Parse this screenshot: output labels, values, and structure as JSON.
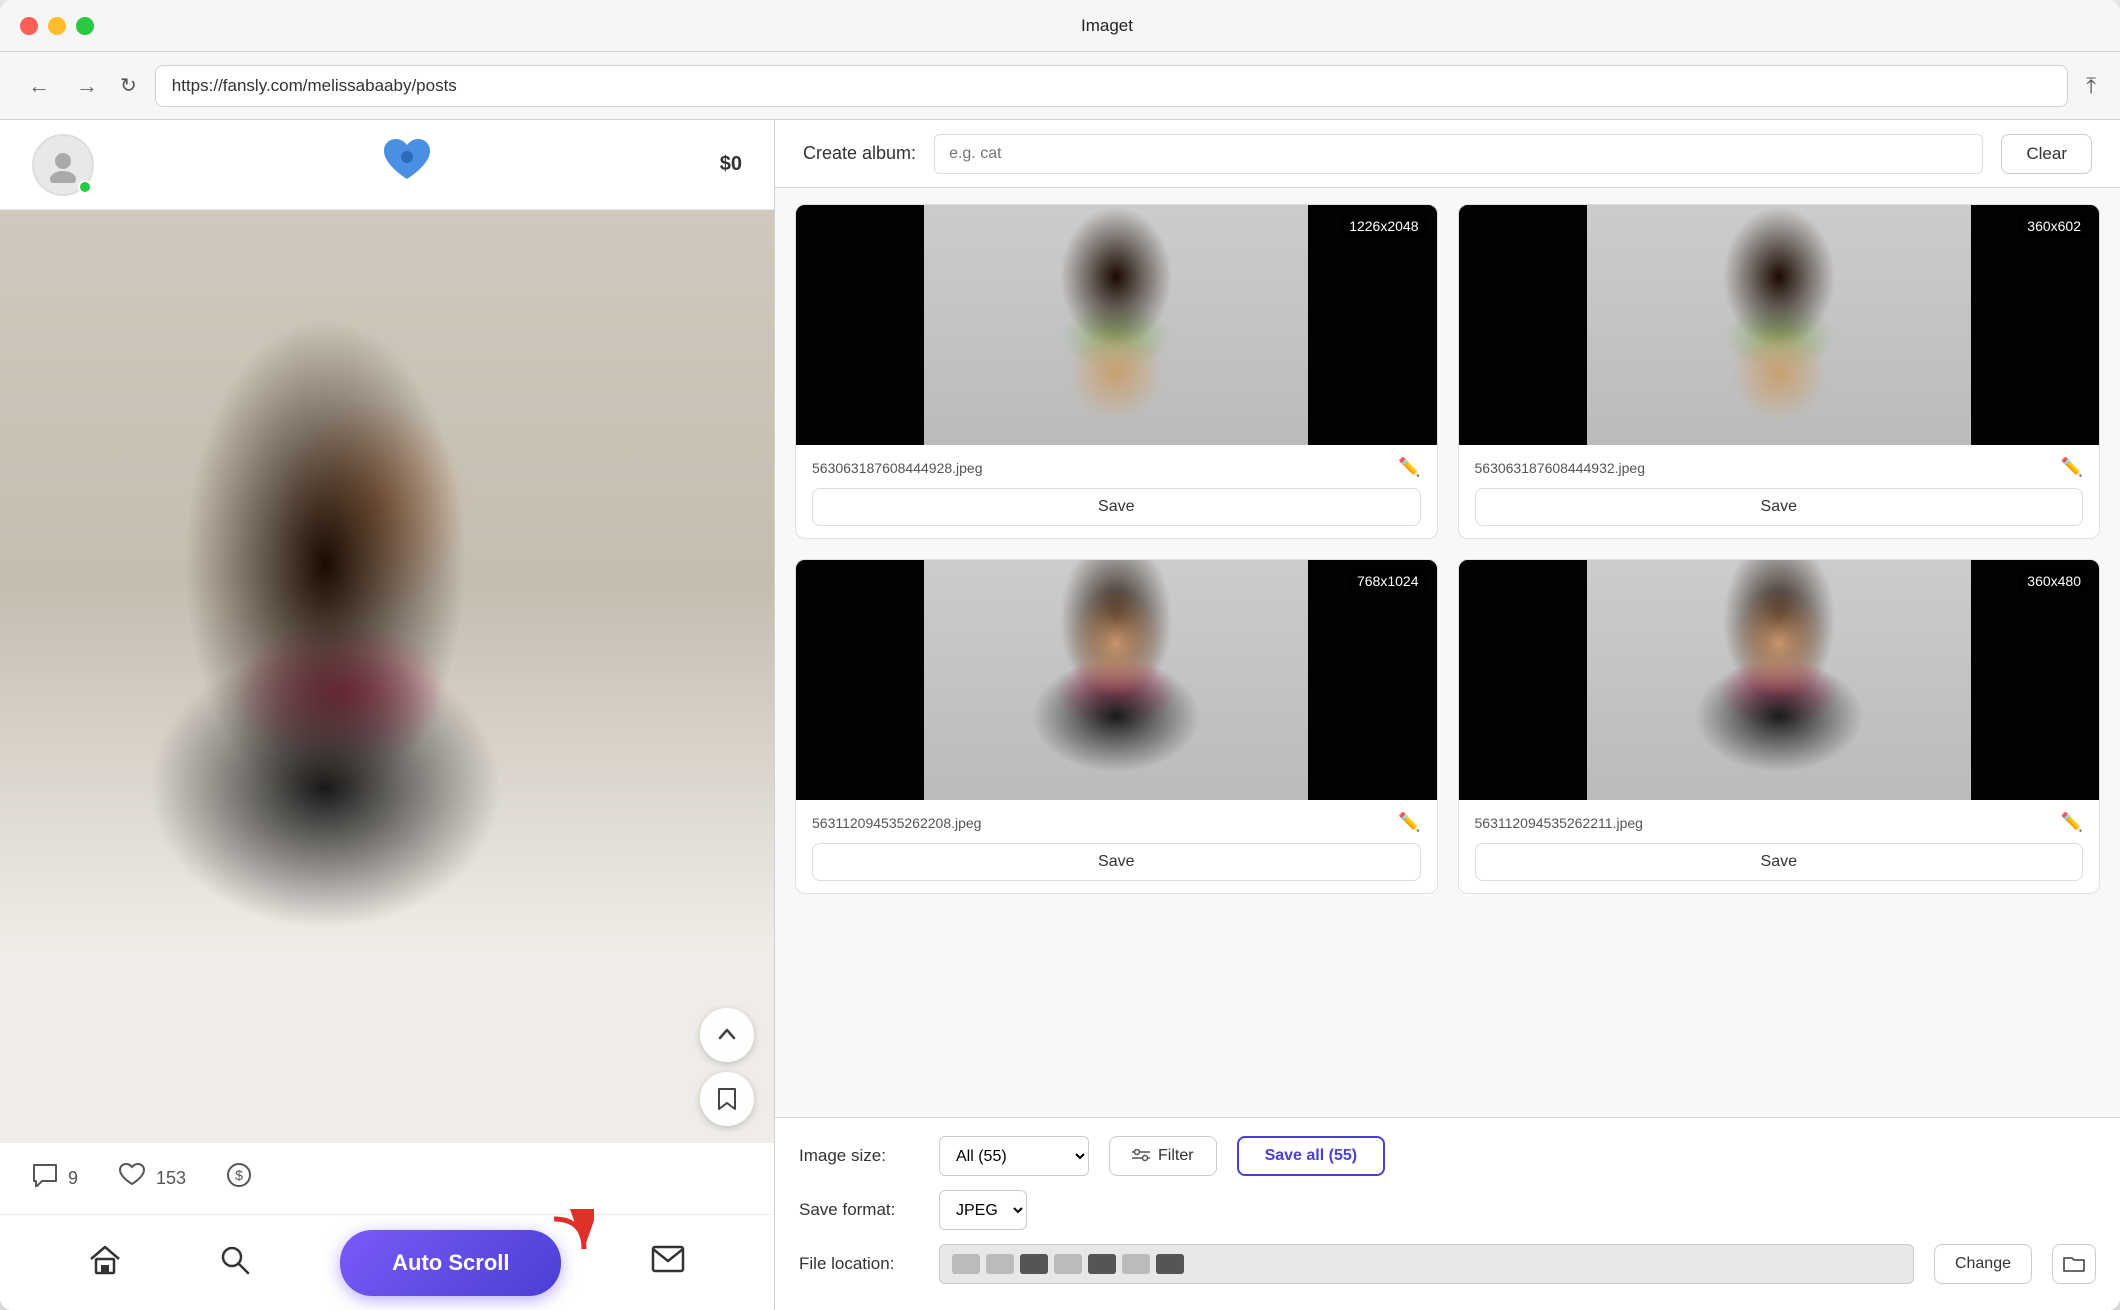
{
  "window": {
    "title": "Imaget"
  },
  "browser": {
    "url": "https://fansly.com/melissabaaby/posts",
    "back_label": "←",
    "forward_label": "→",
    "refresh_label": "↻"
  },
  "fansly": {
    "balance": "$0",
    "stats": {
      "comments": "9",
      "likes": "153"
    }
  },
  "scroll_btn_label": "↑",
  "bookmark_icon": "🔖",
  "auto_scroll_label": "Auto Scroll",
  "bottom_icons": {
    "home": "⌂",
    "search": "🔍",
    "mail": "✉"
  },
  "imaget": {
    "album_label": "Create album:",
    "album_placeholder": "e.g. cat",
    "clear_label": "Clear",
    "images": [
      {
        "filename": "563063187608444928.jpeg",
        "size": "1226x2048",
        "save_label": "Save",
        "type": "back"
      },
      {
        "filename": "563063187608444932.jpeg",
        "size": "360x602",
        "save_label": "Save",
        "type": "back"
      },
      {
        "filename": "563112094535262208.jpeg",
        "size": "768x1024",
        "save_label": "Save",
        "type": "front"
      },
      {
        "filename": "563112094535262211.jpeg",
        "size": "360x480",
        "save_label": "Save",
        "type": "front"
      }
    ],
    "controls": {
      "image_size_label": "Image size:",
      "image_size_value": "All (55)",
      "filter_label": "Filter",
      "save_all_label": "Save all (55)",
      "save_format_label": "Save format:",
      "format_value": "JPEG",
      "file_location_label": "File location:",
      "change_label": "Change"
    }
  }
}
